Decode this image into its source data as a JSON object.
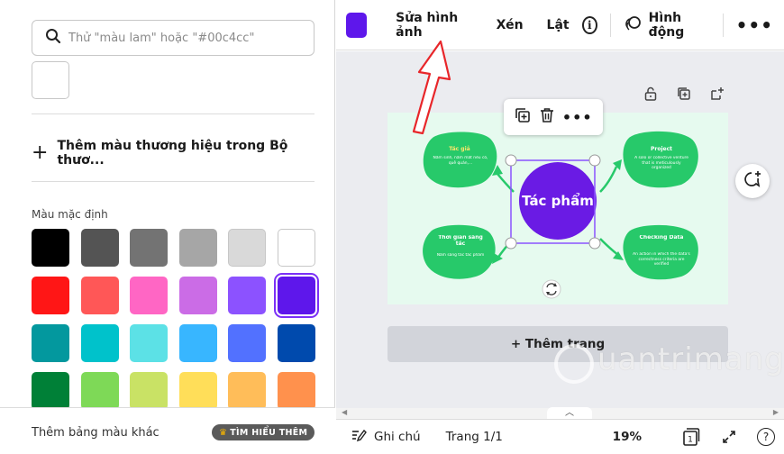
{
  "colors": {
    "selected_color": "#5e17eb",
    "accent": "#7b2ff7",
    "annotation_arrow": "#e8262a",
    "page_background": "#e6faef",
    "bubble_green": "#27c96a",
    "center_purple": "#6a1be4"
  },
  "left_panel": {
    "search_placeholder": "Thử \"màu lam\" hoặc \"#00c4cc\"",
    "brand_kit_label": "Thêm màu thương hiệu trong Bộ thươ...",
    "default_colors_label": "Màu mặc định",
    "swatches": [
      "#000000",
      "#545454",
      "#737373",
      "#a6a6a6",
      "#d9d9d9",
      "#ffffff",
      "#ff1616",
      "#ff5757",
      "#ff66c4",
      "#cb6ce6",
      "#8c52ff",
      "#5e17eb",
      "#03989e",
      "#00c2cb",
      "#5ce1e6",
      "#38b6ff",
      "#5271ff",
      "#004aad",
      "#008037",
      "#7ed957",
      "#c9e265",
      "#ffde59",
      "#ffbd59",
      "#ff914d"
    ],
    "more_palettes_label": "Thêm bảng màu khác",
    "learn_more_label": "TÌM HIỂU THÊM"
  },
  "toolbar": {
    "edit_image": "Sửa hình ảnh",
    "crop": "Xén",
    "flip": "Lật",
    "info": "i",
    "animate": "Hình động",
    "more": "•••"
  },
  "canvas": {
    "center_label": "Tác phẩm",
    "bubbles": [
      {
        "title": "Tác giả",
        "body": "Năm sinh, năm mất nếu có, quê quán,..."
      },
      {
        "title": "Project",
        "body": "A solo or collective venture that is meticulously organized"
      },
      {
        "title": "Thời gian sáng tác",
        "body": "Năm sáng tác tác phẩm"
      },
      {
        "title": "Checking Data",
        "body": "An action in which the data's correctness criteria are verified"
      }
    ],
    "add_page_label": "+ Thêm trang",
    "watermark": "uantrimang"
  },
  "bottom_bar": {
    "notes_label": "Ghi chú",
    "page_indicator": "Trang 1/1",
    "zoom": "19%",
    "page_count": "1",
    "help": "?"
  }
}
